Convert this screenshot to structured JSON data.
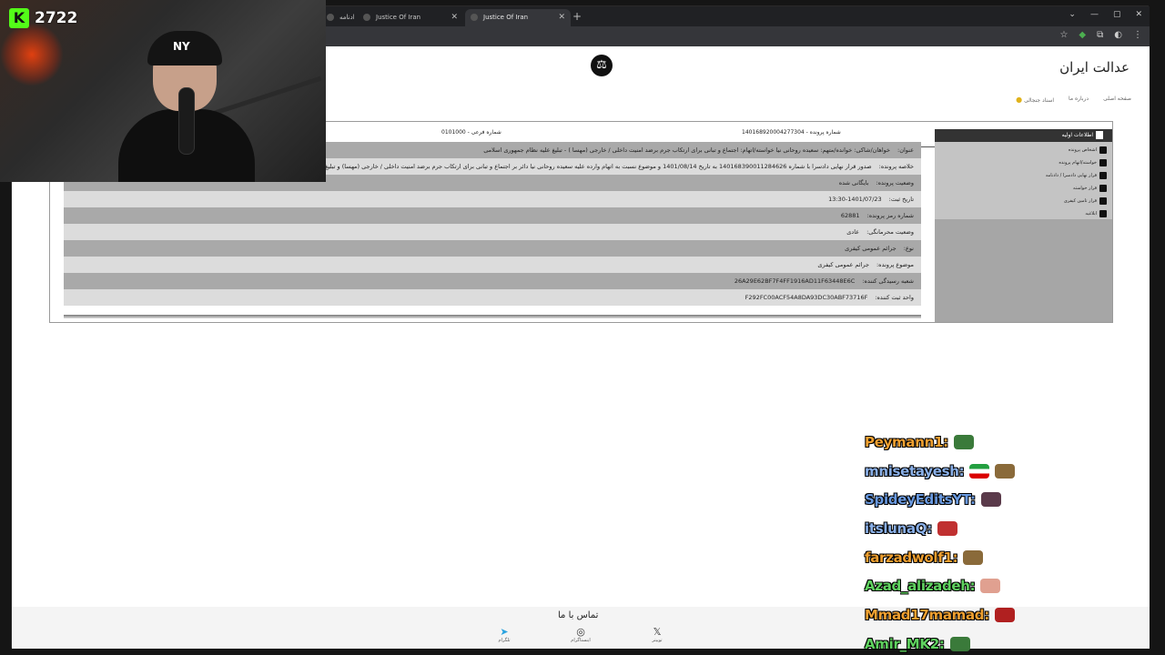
{
  "stream": {
    "viewer_count": "2722",
    "platform_logo": "K"
  },
  "browser": {
    "tabs": [
      {
        "title": "دادنامه"
      },
      {
        "title": "Justice Of Iran"
      },
      {
        "title": "Justice Of Iran"
      }
    ],
    "new_tab": "+"
  },
  "site": {
    "title": "عدالت ایران",
    "nav": [
      {
        "label": "صفحه اصلی"
      },
      {
        "label": "درباره ما"
      },
      {
        "label": "اسناد جنجالی"
      }
    ]
  },
  "case": {
    "case_number_label": "شماره پرونده - 140168920004277304",
    "sub_number_label": "شماره فرعی - 0101000",
    "rows": [
      {
        "label": "عنوان:",
        "value": "خواهان/شاکی: خوانده/متهم: سعیده روحانی نیا خواسته/اتهام: اجتماع و تبانی برای ارتکاب جرم برضد امنیت داخلی / خارجی (مهسا ) - تبلیغ علیه نظام جمهوری اسلامی"
      },
      {
        "label": "خلاصه پرونده:",
        "value": "صدور قرار نهایی دادسرا با شماره 140168390011284626 به تاریخ 1401/08/14 و موضوع نسبت به اتهام وارده علیه سعیده روحانی نیا دائر بر اجتماع و تبانی برای ارتکاب جرم برضد امنیت داخلی / خارجی (مهسا) و تبلیغ علیه نظام جمهوری اسلامی جلب به دادرسی"
      },
      {
        "label": "وضعیت پرونده:",
        "value": "بایگانی شده"
      },
      {
        "label": "تاریخ ثبت:",
        "value": "1401/07/23-13:30"
      },
      {
        "label": "شماره رمز پرونده:",
        "value": "62881"
      },
      {
        "label": "وضعیت محرمانگی:",
        "value": "عادی"
      },
      {
        "label": "نوع:",
        "value": "جرائم عمومی کیفری"
      },
      {
        "label": "موضوع پرونده:",
        "value": "جرائم عمومی کیفری"
      },
      {
        "label": "شعبه رسیدگی کننده:",
        "value": "26A29E62BF7F4FF1916AD11F63448E6C"
      },
      {
        "label": "واحد ثبت کننده:",
        "value": "F292FC00ACF54A8DA93DC30ABF73716F"
      }
    ]
  },
  "sidebar": {
    "header": "اطلاعات اولیه",
    "items": [
      {
        "label": "اشخاص پرونده",
        "icon": "people-icon"
      },
      {
        "label": "خواسته/اتهام پرونده",
        "icon": "hand-icon"
      },
      {
        "label": "قرار نهایی دادسرا / دادنامه",
        "icon": "gavel-icon"
      },
      {
        "label": "قرار خواسته",
        "icon": "document-icon"
      },
      {
        "label": "قرار تامین کیفری",
        "icon": "document-icon"
      },
      {
        "label": "ابلاغیه",
        "icon": "mail-icon"
      }
    ]
  },
  "contact": {
    "title": "تماس با ما",
    "links": [
      {
        "label": "تلگرام",
        "icon": "telegram-icon"
      },
      {
        "label": "اینستاگرام",
        "icon": "instagram-icon"
      },
      {
        "label": "توییتر",
        "icon": "x-icon"
      }
    ]
  },
  "chat": [
    {
      "user": "Peymann1:",
      "color": "#f0a030",
      "emote": "frog-emote"
    },
    {
      "user": "mnisetayesh:",
      "color": "#8ab0e8",
      "emote": "flag-emote"
    },
    {
      "user": "SpideyEditsYT:",
      "color": "#6a9ae0",
      "emote": "face-emote"
    },
    {
      "user": "itslunaQ:",
      "color": "#8ab0e8",
      "emote": "red-emote"
    },
    {
      "user": "farzadwolf1:",
      "color": "#f0a030",
      "emote": "horse-emote"
    },
    {
      "user": "Azad_alizadeh:",
      "color": "#5fd35f",
      "emote": "finger-emote"
    },
    {
      "user": "Mmad17mamad:",
      "color": "#f0a030",
      "emote": "angry-emote"
    },
    {
      "user": "Amir_MK2:",
      "color": "#5fd35f",
      "emote": "frog-emote"
    }
  ]
}
